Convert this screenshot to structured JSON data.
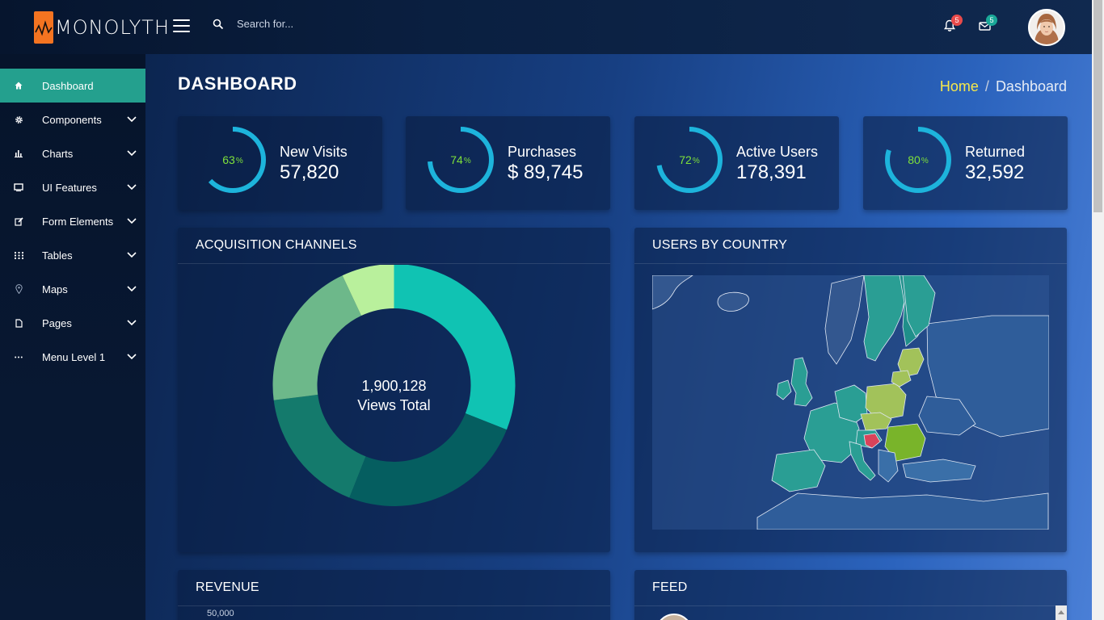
{
  "app": {
    "logo_text": "MONOLYTH"
  },
  "topbar": {
    "search_placeholder": "Search for...",
    "notifications_count": "5",
    "messages_count": "5"
  },
  "sidebar": {
    "items": [
      {
        "label": "Dashboard",
        "icon": "home-icon"
      },
      {
        "label": "Components",
        "icon": "gear-icon"
      },
      {
        "label": "Charts",
        "icon": "bar-chart-icon"
      },
      {
        "label": "UI Features",
        "icon": "monitor-icon"
      },
      {
        "label": "Form Elements",
        "icon": "edit-icon"
      },
      {
        "label": "Tables",
        "icon": "grid-icon"
      },
      {
        "label": "Maps",
        "icon": "map-pin-icon"
      },
      {
        "label": "Pages",
        "icon": "file-icon"
      },
      {
        "label": "Menu Level 1",
        "icon": "dots-icon"
      }
    ]
  },
  "page": {
    "title": "DASHBOARD",
    "breadcrumb_home": "Home",
    "breadcrumb_separator": "/",
    "breadcrumb_current": "Dashboard"
  },
  "stats": [
    {
      "percent": 63,
      "percent_text": "63",
      "unit": "%",
      "label": "New Visits",
      "value": "57,820"
    },
    {
      "percent": 74,
      "percent_text": "74",
      "unit": "%",
      "label": "Purchases",
      "value": "$ 89,745"
    },
    {
      "percent": 72,
      "percent_text": "72",
      "unit": "%",
      "label": "Active Users",
      "value": "178,391"
    },
    {
      "percent": 80,
      "percent_text": "80",
      "unit": "%",
      "label": "Returned",
      "value": "32,592"
    }
  ],
  "panels": {
    "acquisition_title": "ACQUISITION CHANNELS",
    "country_title": "USERS BY COUNTRY",
    "revenue_title": "REVENUE",
    "feed_title": "FEED",
    "revenue_axis_top": "50,000"
  },
  "chart_data": {
    "type": "pie",
    "title": "",
    "center_value": "1,900,128",
    "center_label": "Views Total",
    "values": [
      31,
      25,
      17,
      20,
      7
    ],
    "colors": [
      "#10c3b3",
      "#055e60",
      "#147a6c",
      "#6db88a",
      "#b9f09c"
    ]
  },
  "colors": {
    "accent": "#24a08e",
    "ring": "#1db4dc",
    "pct_text": "#7fe13a",
    "home_link": "#f7e84a",
    "logo": "#f47421",
    "badge_red": "#e84a4a",
    "badge_teal": "#1aa898"
  }
}
